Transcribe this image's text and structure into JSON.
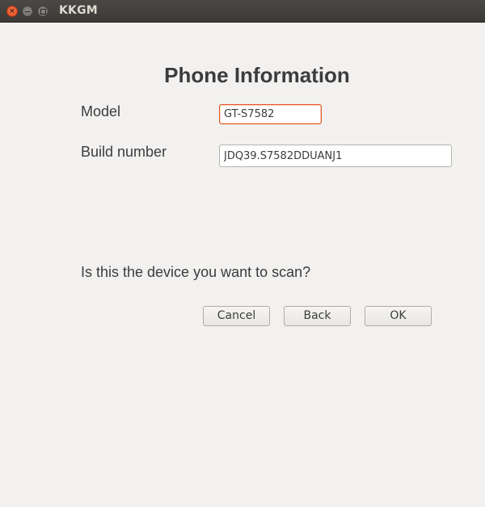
{
  "window": {
    "title": "KKGM",
    "close_glyph": "×"
  },
  "heading": "Phone Information",
  "fields": {
    "model": {
      "label": "Model",
      "value": "GT-S7582"
    },
    "build": {
      "label": "Build number",
      "value": "JDQ39.S7582DDUANJ1"
    }
  },
  "question": "Is this the device you want to scan?",
  "buttons": {
    "cancel": "Cancel",
    "back": "Back",
    "ok": "OK"
  },
  "colors": {
    "background": "#f2f1f0",
    "titlebar": "#3b3a36",
    "focus_border": "#e25a1e",
    "text": "#3c3c3c"
  },
  "icons": {
    "close": "close-icon",
    "minimize": "minimize-icon",
    "maximize": "maximize-icon"
  }
}
